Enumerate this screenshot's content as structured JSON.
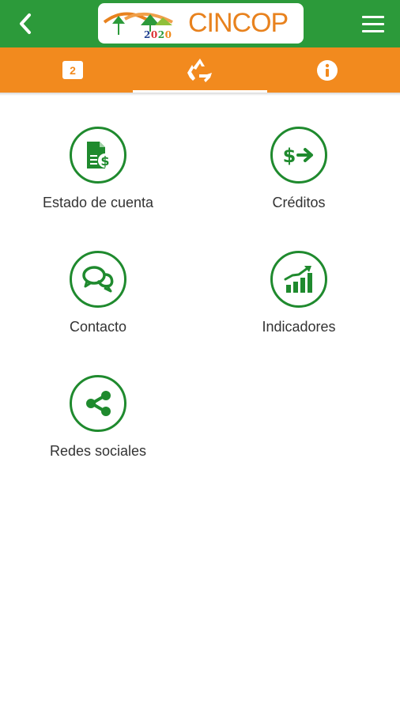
{
  "header": {
    "logo_text": "CINCOP",
    "logo_year": [
      "2",
      "0",
      "2",
      "0"
    ],
    "back_icon": "chevron-left-icon",
    "menu_icon": "hamburger-menu-icon"
  },
  "tabs": {
    "notification_count": "2",
    "middle_icon": "recycle-triangle-icon",
    "right_icon": "info-icon"
  },
  "menu": {
    "items": [
      {
        "label": "Estado de cuenta",
        "icon": "account-statement-icon"
      },
      {
        "label": "Créditos",
        "icon": "credit-transfer-icon"
      },
      {
        "label": "Contacto",
        "icon": "chat-bubbles-icon"
      },
      {
        "label": "Indicadores",
        "icon": "bar-chart-growth-icon"
      },
      {
        "label": "Redes sociales",
        "icon": "share-icon"
      }
    ]
  },
  "colors": {
    "header_green": "#2c9a3a",
    "tab_orange": "#f28a1e",
    "icon_green": "#1f8a2e",
    "logo_orange": "#e8821e"
  }
}
